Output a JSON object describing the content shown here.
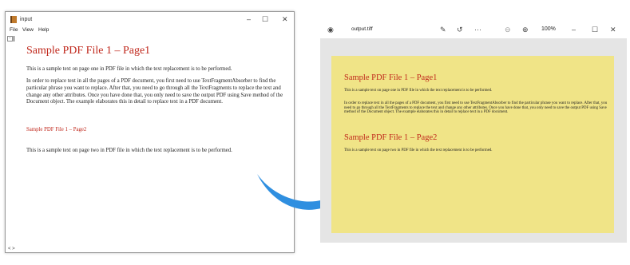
{
  "left_window": {
    "title": "input",
    "controls": {
      "minimize": "–",
      "maximize": "☐",
      "close": "✕"
    },
    "menu": [
      "File",
      "View",
      "Help"
    ],
    "collapse": "−",
    "scroll": "< >"
  },
  "document": {
    "heading1": "Sample PDF File 1 – Page1",
    "para1": "This is a sample text on page one in PDF file in which the text replacement is to be performed.",
    "para2": "In order to replace text in all the pages of a PDF document, you first need to use TextFragmentAbsorber to find the particular phrase you want to replace. After that, you need to go through all the TextFragments to replace the text and change any other attributes. Once you have done that, you only need to save the output PDF using Save method of the Document object. The example elaborates this in detail to replace text in a PDF document.",
    "heading2": "Sample PDF File 1 – Page2",
    "para3": "This is a sample text on page two in PDF file in which the text replacement is to be performed."
  },
  "right_window": {
    "filename": "output.tiff",
    "zoom": "100%",
    "icons": [
      "viewer-app-icon",
      "edit-image-icon",
      "rotate-icon",
      "more-icon",
      "zoom-out-icon",
      "zoom-in-icon"
    ],
    "icon_glyphs": {
      "app": "◉",
      "edit": "✎",
      "rotate": "↺",
      "more": "···",
      "zoom_out": "⊖",
      "zoom_in": "⊕"
    },
    "controls": {
      "minimize": "–",
      "maximize": "☐",
      "close": "✕"
    }
  },
  "colors": {
    "heading_red": "#c0281c",
    "canvas_yellow": "#f0e487",
    "arrow_blue": "#2f8fe0",
    "viewer_gray": "#e5e5e5"
  }
}
